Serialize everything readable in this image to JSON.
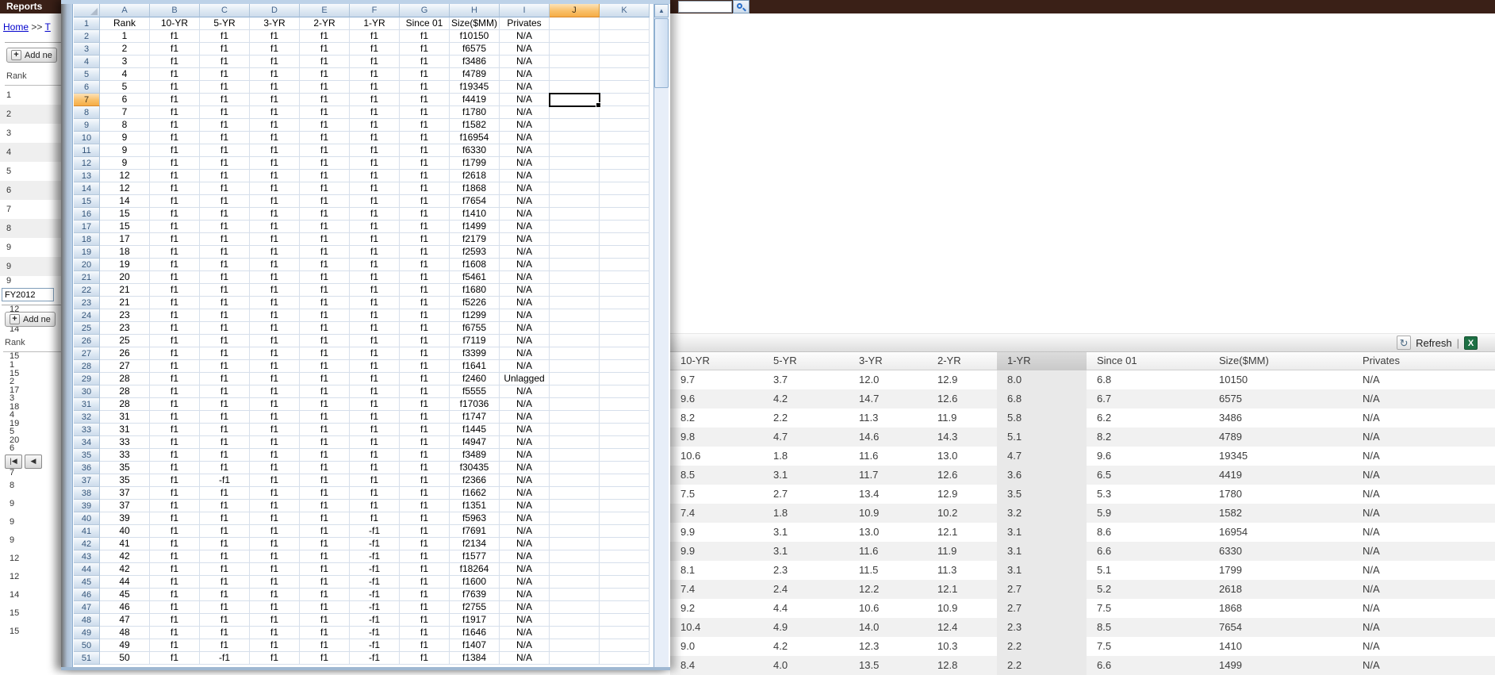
{
  "top_bar": {
    "title": "Reports",
    "search_value": ""
  },
  "left_panel": {
    "breadcrumb": {
      "home": "Home",
      "separator": ">>",
      "section": "T"
    },
    "add_button_label": "Add ne",
    "grid1": {
      "header": "Rank",
      "rows": [
        "1",
        "2",
        "3",
        "4",
        "5",
        "6",
        "7",
        "8",
        "9",
        "9"
      ],
      "partial_row": "9"
    },
    "filter_value": "FY2012",
    "grid2": {
      "ghost_top": "12",
      "add_button_label": "Add ne",
      "ghost_mid": "14",
      "header": "Rank",
      "ghost_header": "15",
      "tokens_top": [
        "1",
        "15",
        "2",
        "17",
        "3",
        "18",
        "4",
        "19",
        "5",
        "20",
        "6"
      ],
      "pager_first": "|◀",
      "pager_prev": "◀",
      "overlap_row": "7",
      "tokens_bottom": [
        "8",
        "9",
        "9",
        "9",
        "12",
        "12",
        "14",
        "15",
        "15"
      ]
    }
  },
  "spreadsheet": {
    "selected_cell": "J7",
    "col_headers": [
      "",
      "A",
      "B",
      "C",
      "D",
      "E",
      "F",
      "G",
      "H",
      "I",
      "J",
      "K"
    ],
    "scroll_up_glyph": "▲",
    "rows": [
      [
        "1",
        "Rank",
        "10-YR",
        "5-YR",
        "3-YR",
        "2-YR",
        "1-YR",
        "Since 01",
        "Size($MM)",
        "Privates",
        "",
        ""
      ],
      [
        "2",
        "1",
        "f1",
        "f1",
        "f1",
        "f1",
        "f1",
        "f1",
        "f10150",
        "N/A",
        "",
        ""
      ],
      [
        "3",
        "2",
        "f1",
        "f1",
        "f1",
        "f1",
        "f1",
        "f1",
        "f6575",
        "N/A",
        "",
        ""
      ],
      [
        "4",
        "3",
        "f1",
        "f1",
        "f1",
        "f1",
        "f1",
        "f1",
        "f3486",
        "N/A",
        "",
        ""
      ],
      [
        "5",
        "4",
        "f1",
        "f1",
        "f1",
        "f1",
        "f1",
        "f1",
        "f4789",
        "N/A",
        "",
        ""
      ],
      [
        "6",
        "5",
        "f1",
        "f1",
        "f1",
        "f1",
        "f1",
        "f1",
        "f19345",
        "N/A",
        "",
        ""
      ],
      [
        "7",
        "6",
        "f1",
        "f1",
        "f1",
        "f1",
        "f1",
        "f1",
        "f4419",
        "N/A",
        "",
        ""
      ],
      [
        "8",
        "7",
        "f1",
        "f1",
        "f1",
        "f1",
        "f1",
        "f1",
        "f1780",
        "N/A",
        "",
        ""
      ],
      [
        "9",
        "8",
        "f1",
        "f1",
        "f1",
        "f1",
        "f1",
        "f1",
        "f1582",
        "N/A",
        "",
        ""
      ],
      [
        "10",
        "9",
        "f1",
        "f1",
        "f1",
        "f1",
        "f1",
        "f1",
        "f16954",
        "N/A",
        "",
        ""
      ],
      [
        "11",
        "9",
        "f1",
        "f1",
        "f1",
        "f1",
        "f1",
        "f1",
        "f6330",
        "N/A",
        "",
        ""
      ],
      [
        "12",
        "9",
        "f1",
        "f1",
        "f1",
        "f1",
        "f1",
        "f1",
        "f1799",
        "N/A",
        "",
        ""
      ],
      [
        "13",
        "12",
        "f1",
        "f1",
        "f1",
        "f1",
        "f1",
        "f1",
        "f2618",
        "N/A",
        "",
        ""
      ],
      [
        "14",
        "12",
        "f1",
        "f1",
        "f1",
        "f1",
        "f1",
        "f1",
        "f1868",
        "N/A",
        "",
        ""
      ],
      [
        "15",
        "14",
        "f1",
        "f1",
        "f1",
        "f1",
        "f1",
        "f1",
        "f7654",
        "N/A",
        "",
        ""
      ],
      [
        "16",
        "15",
        "f1",
        "f1",
        "f1",
        "f1",
        "f1",
        "f1",
        "f1410",
        "N/A",
        "",
        ""
      ],
      [
        "17",
        "15",
        "f1",
        "f1",
        "f1",
        "f1",
        "f1",
        "f1",
        "f1499",
        "N/A",
        "",
        ""
      ],
      [
        "18",
        "17",
        "f1",
        "f1",
        "f1",
        "f1",
        "f1",
        "f1",
        "f2179",
        "N/A",
        "",
        ""
      ],
      [
        "19",
        "18",
        "f1",
        "f1",
        "f1",
        "f1",
        "f1",
        "f1",
        "f2593",
        "N/A",
        "",
        ""
      ],
      [
        "20",
        "19",
        "f1",
        "f1",
        "f1",
        "f1",
        "f1",
        "f1",
        "f1608",
        "N/A",
        "",
        ""
      ],
      [
        "21",
        "20",
        "f1",
        "f1",
        "f1",
        "f1",
        "f1",
        "f1",
        "f5461",
        "N/A",
        "",
        ""
      ],
      [
        "22",
        "21",
        "f1",
        "f1",
        "f1",
        "f1",
        "f1",
        "f1",
        "f1680",
        "N/A",
        "",
        ""
      ],
      [
        "23",
        "21",
        "f1",
        "f1",
        "f1",
        "f1",
        "f1",
        "f1",
        "f5226",
        "N/A",
        "",
        ""
      ],
      [
        "24",
        "23",
        "f1",
        "f1",
        "f1",
        "f1",
        "f1",
        "f1",
        "f1299",
        "N/A",
        "",
        ""
      ],
      [
        "25",
        "23",
        "f1",
        "f1",
        "f1",
        "f1",
        "f1",
        "f1",
        "f6755",
        "N/A",
        "",
        ""
      ],
      [
        "26",
        "25",
        "f1",
        "f1",
        "f1",
        "f1",
        "f1",
        "f1",
        "f7119",
        "N/A",
        "",
        ""
      ],
      [
        "27",
        "26",
        "f1",
        "f1",
        "f1",
        "f1",
        "f1",
        "f1",
        "f3399",
        "N/A",
        "",
        ""
      ],
      [
        "28",
        "27",
        "f1",
        "f1",
        "f1",
        "f1",
        "f1",
        "f1",
        "f1641",
        "N/A",
        "",
        ""
      ],
      [
        "29",
        "28",
        "f1",
        "f1",
        "f1",
        "f1",
        "f1",
        "f1",
        "f2460",
        "Unlagged",
        "",
        ""
      ],
      [
        "30",
        "28",
        "f1",
        "f1",
        "f1",
        "f1",
        "f1",
        "f1",
        "f5555",
        "N/A",
        "",
        ""
      ],
      [
        "31",
        "28",
        "f1",
        "f1",
        "f1",
        "f1",
        "f1",
        "f1",
        "f17036",
        "N/A",
        "",
        ""
      ],
      [
        "32",
        "31",
        "f1",
        "f1",
        "f1",
        "f1",
        "f1",
        "f1",
        "f1747",
        "N/A",
        "",
        ""
      ],
      [
        "33",
        "31",
        "f1",
        "f1",
        "f1",
        "f1",
        "f1",
        "f1",
        "f1445",
        "N/A",
        "",
        ""
      ],
      [
        "34",
        "33",
        "f1",
        "f1",
        "f1",
        "f1",
        "f1",
        "f1",
        "f4947",
        "N/A",
        "",
        ""
      ],
      [
        "35",
        "33",
        "f1",
        "f1",
        "f1",
        "f1",
        "f1",
        "f1",
        "f3489",
        "N/A",
        "",
        ""
      ],
      [
        "36",
        "35",
        "f1",
        "f1",
        "f1",
        "f1",
        "f1",
        "f1",
        "f30435",
        "N/A",
        "",
        ""
      ],
      [
        "37",
        "35",
        "f1",
        "-f1",
        "f1",
        "f1",
        "f1",
        "f1",
        "f2366",
        "N/A",
        "",
        ""
      ],
      [
        "38",
        "37",
        "f1",
        "f1",
        "f1",
        "f1",
        "f1",
        "f1",
        "f1662",
        "N/A",
        "",
        ""
      ],
      [
        "39",
        "37",
        "f1",
        "f1",
        "f1",
        "f1",
        "f1",
        "f1",
        "f1351",
        "N/A",
        "",
        ""
      ],
      [
        "40",
        "39",
        "f1",
        "f1",
        "f1",
        "f1",
        "f1",
        "f1",
        "f5963",
        "N/A",
        "",
        ""
      ],
      [
        "41",
        "40",
        "f1",
        "f1",
        "f1",
        "f1",
        "-f1",
        "f1",
        "f7691",
        "N/A",
        "",
        ""
      ],
      [
        "42",
        "41",
        "f1",
        "f1",
        "f1",
        "f1",
        "-f1",
        "f1",
        "f2134",
        "N/A",
        "",
        ""
      ],
      [
        "43",
        "42",
        "f1",
        "f1",
        "f1",
        "f1",
        "-f1",
        "f1",
        "f1577",
        "N/A",
        "",
        ""
      ],
      [
        "44",
        "42",
        "f1",
        "f1",
        "f1",
        "f1",
        "-f1",
        "f1",
        "f18264",
        "N/A",
        "",
        ""
      ],
      [
        "45",
        "44",
        "f1",
        "f1",
        "f1",
        "f1",
        "-f1",
        "f1",
        "f1600",
        "N/A",
        "",
        ""
      ],
      [
        "46",
        "45",
        "f1",
        "f1",
        "f1",
        "f1",
        "-f1",
        "f1",
        "f7639",
        "N/A",
        "",
        ""
      ],
      [
        "47",
        "46",
        "f1",
        "f1",
        "f1",
        "f1",
        "-f1",
        "f1",
        "f2755",
        "N/A",
        "",
        ""
      ],
      [
        "48",
        "47",
        "f1",
        "f1",
        "f1",
        "f1",
        "-f1",
        "f1",
        "f1917",
        "N/A",
        "",
        ""
      ],
      [
        "49",
        "48",
        "f1",
        "f1",
        "f1",
        "f1",
        "-f1",
        "f1",
        "f1646",
        "N/A",
        "",
        ""
      ],
      [
        "50",
        "49",
        "f1",
        "f1",
        "f1",
        "f1",
        "-f1",
        "f1",
        "f1407",
        "N/A",
        "",
        ""
      ],
      [
        "51",
        "50",
        "f1",
        "-f1",
        "f1",
        "f1",
        "-f1",
        "f1",
        "f1384",
        "N/A",
        "",
        ""
      ]
    ]
  },
  "right_panel": {
    "toolbar": {
      "refresh_icon": "↻",
      "refresh_label": "Refresh",
      "divider": "|",
      "excel_export": "X"
    },
    "table": {
      "headers": [
        "10-YR",
        "5-YR",
        "3-YR",
        "2-YR",
        "1-YR",
        "Since 01",
        "Size($MM)",
        "Privates"
      ],
      "highlighted_column": "1-YR",
      "rows": [
        [
          "9.7",
          "3.7",
          "12.0",
          "12.9",
          "8.0",
          "6.8",
          "10150",
          "N/A"
        ],
        [
          "9.6",
          "4.2",
          "14.7",
          "12.6",
          "6.8",
          "6.7",
          "6575",
          "N/A"
        ],
        [
          "8.2",
          "2.2",
          "11.3",
          "11.9",
          "5.8",
          "6.2",
          "3486",
          "N/A"
        ],
        [
          "9.8",
          "4.7",
          "14.6",
          "14.3",
          "5.1",
          "8.2",
          "4789",
          "N/A"
        ],
        [
          "10.6",
          "1.8",
          "11.6",
          "13.0",
          "4.7",
          "9.6",
          "19345",
          "N/A"
        ],
        [
          "8.5",
          "3.1",
          "11.7",
          "12.6",
          "3.6",
          "6.5",
          "4419",
          "N/A"
        ],
        [
          "7.5",
          "2.7",
          "13.4",
          "12.9",
          "3.5",
          "5.3",
          "1780",
          "N/A"
        ],
        [
          "7.4",
          "1.8",
          "10.9",
          "10.2",
          "3.2",
          "5.9",
          "1582",
          "N/A"
        ],
        [
          "9.9",
          "3.1",
          "13.0",
          "12.1",
          "3.1",
          "8.6",
          "16954",
          "N/A"
        ],
        [
          "9.9",
          "3.1",
          "11.6",
          "11.9",
          "3.1",
          "6.6",
          "6330",
          "N/A"
        ],
        [
          "8.1",
          "2.3",
          "11.5",
          "11.3",
          "3.1",
          "5.1",
          "1799",
          "N/A"
        ],
        [
          "7.4",
          "2.4",
          "12.2",
          "12.1",
          "2.7",
          "5.2",
          "2618",
          "N/A"
        ],
        [
          "9.2",
          "4.4",
          "10.6",
          "10.9",
          "2.7",
          "7.5",
          "1868",
          "N/A"
        ],
        [
          "10.4",
          "4.9",
          "14.0",
          "12.4",
          "2.3",
          "8.5",
          "7654",
          "N/A"
        ],
        [
          "9.0",
          "4.2",
          "12.3",
          "10.3",
          "2.2",
          "7.5",
          "1410",
          "N/A"
        ],
        [
          "8.4",
          "4.0",
          "13.5",
          "12.8",
          "2.2",
          "6.6",
          "1499",
          "N/A"
        ]
      ]
    }
  }
}
